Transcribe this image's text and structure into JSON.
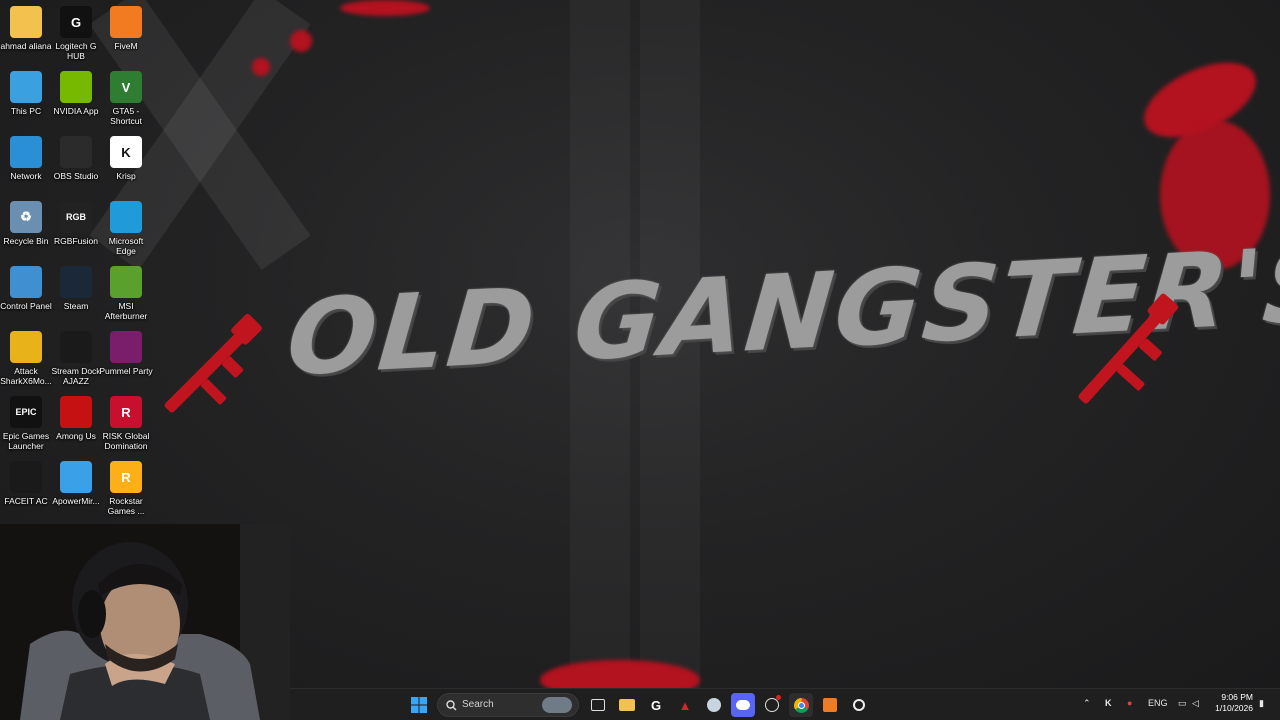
{
  "wallpaper": {
    "title": "OLD GANGSTER'S",
    "accent": "#b3121f"
  },
  "desktop_icons": [
    {
      "label": "ahmad aliana",
      "icon": "folder-icon",
      "color": "#f2c14e"
    },
    {
      "label": "This PC",
      "icon": "monitor-icon",
      "color": "#3aa0e0"
    },
    {
      "label": "Network",
      "icon": "network-icon",
      "color": "#2b8fd6"
    },
    {
      "label": "Recycle Bin",
      "icon": "recycle-bin-icon",
      "color": "#6a8fb0"
    },
    {
      "label": "Control Panel",
      "icon": "control-panel-icon",
      "color": "#3f8fd1"
    },
    {
      "label": "Attack SharkX6Mo...",
      "icon": "attack-shark-icon",
      "color": "#e8b21a"
    },
    {
      "label": "Epic Games Launcher",
      "icon": "epic-games-icon",
      "color": "#111111"
    },
    {
      "label": "FACEIT AC",
      "icon": "faceit-icon",
      "color": "#1a1a1a"
    },
    {
      "label": "Logitech G HUB",
      "icon": "logitech-ghub-icon",
      "color": "#111111"
    },
    {
      "label": "NVIDIA App",
      "icon": "nvidia-icon",
      "color": "#76b900"
    },
    {
      "label": "OBS Studio",
      "icon": "obs-icon",
      "color": "#2b2b2b"
    },
    {
      "label": "RGBFusion",
      "icon": "rgbfusion-icon",
      "color": "#222222"
    },
    {
      "label": "Steam",
      "icon": "steam-icon",
      "color": "#1b2838"
    },
    {
      "label": "Stream Dock AJAZZ",
      "icon": "stream-dock-icon",
      "color": "#1a1a1a"
    },
    {
      "label": "Among Us",
      "icon": "among-us-icon",
      "color": "#c51111"
    },
    {
      "label": "ApowerMir...",
      "icon": "apowermirror-icon",
      "color": "#3aa0e8"
    },
    {
      "label": "FiveM",
      "icon": "fivem-icon",
      "color": "#f27b22"
    },
    {
      "label": "GTA5 - Shortcut",
      "icon": "gta5-icon",
      "color": "#2f7d32"
    },
    {
      "label": "Krisp",
      "icon": "krisp-icon",
      "color": "#ffffff"
    },
    {
      "label": "Microsoft Edge",
      "icon": "edge-icon",
      "color": "#1f9bd9"
    },
    {
      "label": "MSI Afterburner",
      "icon": "msi-afterburner-icon",
      "color": "#5aa02c"
    },
    {
      "label": "Pummel Party",
      "icon": "pummel-party-icon",
      "color": "#7a1e6b"
    },
    {
      "label": "RISK Global Domination",
      "icon": "risk-icon",
      "color": "#c8102e"
    },
    {
      "label": "Rockstar Games ...",
      "icon": "rockstar-icon",
      "color": "#fcaf17"
    }
  ],
  "icon_glyphs": {
    "folder-icon": "",
    "monitor-icon": "",
    "network-icon": "",
    "recycle-bin-icon": "♻",
    "control-panel-icon": "",
    "attack-shark-icon": "",
    "epic-games-icon": "EPIC",
    "faceit-icon": "",
    "logitech-ghub-icon": "G",
    "nvidia-icon": "",
    "obs-icon": "",
    "rgbfusion-icon": "RGB",
    "steam-icon": "",
    "stream-dock-icon": "",
    "among-us-icon": "",
    "apowermirror-icon": "",
    "fivem-icon": "",
    "gta5-icon": "V",
    "krisp-icon": "K",
    "edge-icon": "",
    "msi-afterburner-icon": "",
    "pummel-party-icon": "",
    "risk-icon": "R",
    "rockstar-icon": "R"
  },
  "taskbar": {
    "search_label": "Search",
    "language": "ENG",
    "time": "9:06 PM",
    "date": "1/10/2026"
  }
}
